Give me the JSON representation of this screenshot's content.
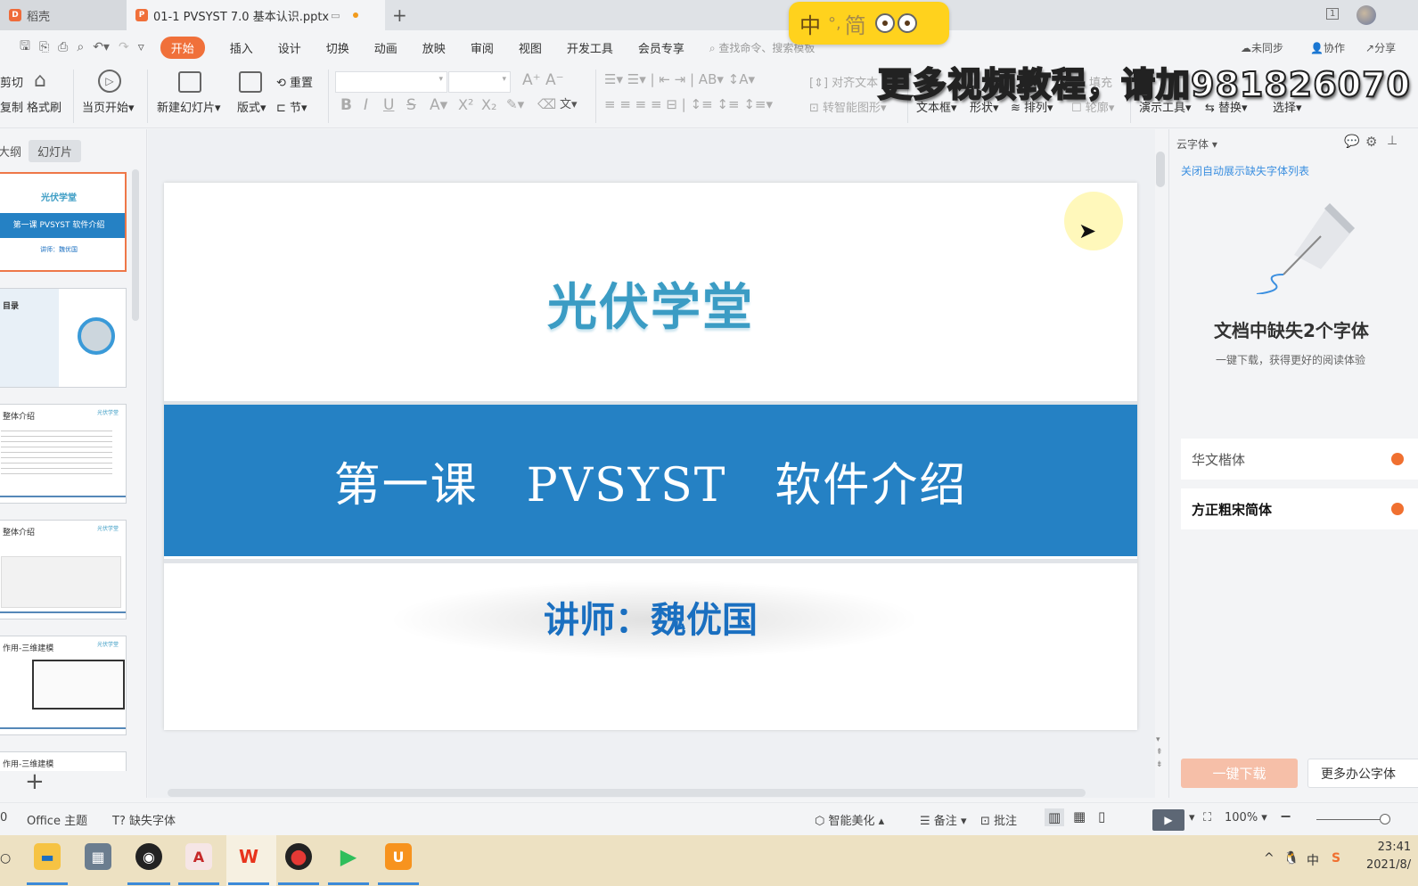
{
  "tabs": [
    {
      "label": "稻壳",
      "icon": "docer-icon",
      "active": false
    },
    {
      "label": "01-1 PVSYST 7.0 基本认识.pptx",
      "icon": "pptx-icon",
      "active": true
    }
  ],
  "topright": {
    "window_badge": "1"
  },
  "quick_access": [
    "save-icon",
    "format-painter-icon",
    "print-icon",
    "print-preview-icon",
    "undo-icon",
    "redo-icon",
    "more-icon"
  ],
  "menu": {
    "items": [
      "开始",
      "插入",
      "设计",
      "切换",
      "动画",
      "放映",
      "审阅",
      "视图",
      "开发工具",
      "会员专享"
    ],
    "active": "开始",
    "search_placeholder": "查找命令、搜索模板",
    "sync": "未同步",
    "collab": "协作",
    "share": "分享"
  },
  "ribbon": {
    "cut": "剪切",
    "copy": "复制",
    "format_painter": "格式刷",
    "start_from_current": "当页开始",
    "new_slide": "新建幻灯片",
    "layout": "版式",
    "reset": "重置",
    "section": "节",
    "font_name": "",
    "font_size": "",
    "align_text": "对齐文本",
    "smart_art": "转智能图形",
    "textbox": "文本框",
    "shape": "形状",
    "arrange": "排列",
    "fill": "填充",
    "outline": "轮廓",
    "present_tools": "演示工具",
    "replace": "替换",
    "select": "选择"
  },
  "ime": {
    "mode": "中",
    "punct": "°,",
    "variant": "简"
  },
  "watermark": "更多视频教程，请加981826070",
  "left_panel": {
    "tabs": [
      "大纲",
      "幻灯片"
    ],
    "active_tab": "幻灯片",
    "thumbnails": [
      {
        "title": "光伏学堂",
        "subtitle": "第一课 PVSYST 软件介绍",
        "lecturer": "讲师：魏优国",
        "selected": true
      },
      {
        "title": "目录",
        "selected": false
      },
      {
        "title": "整体介绍",
        "selected": false
      },
      {
        "title": "整体介绍",
        "selected": false
      },
      {
        "title": "作用-三维建模",
        "selected": false
      },
      {
        "title": "作用-三维建模",
        "selected": false
      }
    ],
    "brand_tag": "光伏学堂"
  },
  "slide": {
    "title": "光伏学堂",
    "subtitle": "第一课　PVSYST　软件介绍",
    "lecturer": "讲师：魏优国",
    "band_color": "#2581c4",
    "title_color": "#3b9cc4",
    "lecturer_color": "#1a6fc0"
  },
  "right_panel": {
    "header": "云字体",
    "link": "关闭自动展示缺失字体列表",
    "title": "文档中缺失2个字体",
    "desc": "一键下载，获得更好的阅读体验",
    "fonts": [
      "华文楷体",
      "方正粗宋简体"
    ],
    "download_btn": "一键下载",
    "more_btn": "更多办公字体"
  },
  "statusbar": {
    "slide_info": "0",
    "theme": "Office 主题",
    "missing_font": "缺失字体",
    "beautify": "智能美化",
    "notes": "备注",
    "comments": "批注",
    "zoom": "100%",
    "zoom_slider_value": 0.9
  },
  "taskbar": {
    "apps": [
      "file-explorer",
      "calculator",
      "app-circle",
      "autocad",
      "wps",
      "recorder",
      "tencent-video",
      "uc-browser"
    ],
    "active_app": "wps",
    "time": "23:41",
    "date": "2021/8/"
  }
}
